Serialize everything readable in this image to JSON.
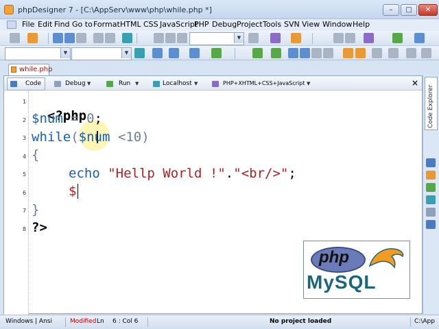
{
  "window": {
    "title": "phpDesigner 7 - [C:\\AppServ\\www\\php\\while.php *]",
    "controls": {
      "minimize": "–",
      "maximize": "□",
      "close": "✕"
    }
  },
  "menu": {
    "items": [
      "File",
      "Edit",
      "Find",
      "Go to",
      "Format",
      "HTML",
      "CSS",
      "JavaScript",
      "PHP",
      "Debug",
      "Project",
      "Tools",
      "SVN",
      "View",
      "Window",
      "Help"
    ]
  },
  "document_tab": {
    "label": "while.php"
  },
  "editor_toolbar": {
    "code_label": "Code",
    "debug_label": "Debug",
    "run_label": "Run",
    "localhost_label": "Localhost",
    "syntax_label": "PHP+XHTML+CSS+JavaScript",
    "dropdown_glyph": "▼",
    "close_glyph": "×"
  },
  "code": {
    "line_numbers": [
      "1",
      "2",
      "3",
      "4",
      "5",
      "6",
      "7",
      "8"
    ],
    "line1": "<?php",
    "line2_var": "$num",
    "line2_op": " = ",
    "line2_num": "0",
    "line2_end": ";",
    "line3_kw": "while",
    "line3_open": "(",
    "line3_var": "$num",
    "line3_op": " <",
    "line3_num": "10",
    "line3_close": ")",
    "line4": "{",
    "line5_kw": "echo",
    "line5_str1": " \"Hellp World !\"",
    "line5_dot": ".",
    "line5_str2": "\"<br/>\"",
    "line5_end": ";",
    "line6": "$",
    "line7": "}",
    "line8": "?>"
  },
  "logo": {
    "php": "php",
    "mysql": "MySQL"
  },
  "side_panel": {
    "tab_label": "Code Explorer"
  },
  "status": {
    "encoding": "Windows | Ansi",
    "modified": "Modified",
    "ln": "Ln",
    "position": "6 : Col  6",
    "project": "No project loaded",
    "path": "C:\\App"
  },
  "colors": {
    "accent": "#1a5fb3",
    "string": "#b21f1f",
    "modified": "#c00000",
    "mysql": "#19657c"
  }
}
